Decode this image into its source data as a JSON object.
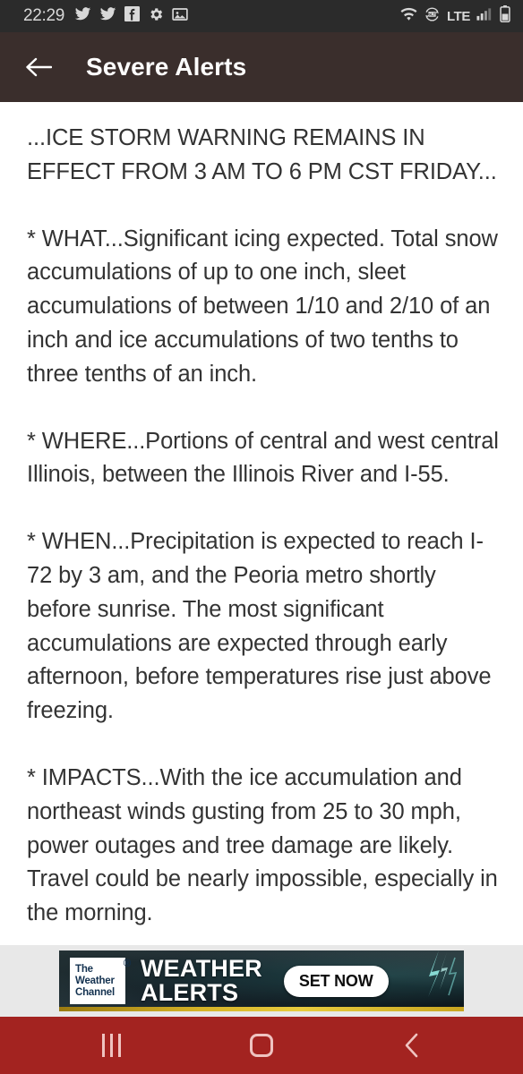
{
  "status_bar": {
    "clock": "22:29",
    "left_icons": [
      "twitter-icon",
      "twitter-icon",
      "facebook-icon",
      "gear-icon",
      "photo-icon"
    ],
    "right_icons": [
      "wifi-icon",
      "volte-icon",
      "signal-bars-icon",
      "battery-icon"
    ],
    "volte_label": "VoLTE",
    "network_label": "LTE",
    "background_color": "#2b2b2b"
  },
  "app_bar": {
    "back_label": "Back",
    "title": "Severe Alerts",
    "background_color": "#3a2e2c"
  },
  "alert": {
    "paragraphs": [
      "...ICE STORM WARNING REMAINS IN EFFECT FROM 3 AM TO 6 PM CST FRIDAY...",
      "* WHAT...Significant icing expected. Total snow accumulations of up to one inch, sleet accumulations of between 1/10 and 2/10 of an inch and ice accumulations of two tenths to three tenths of an inch.",
      "* WHERE...Portions of central and west central Illinois, between the Illinois River and I-55.",
      "* WHEN...Precipitation is expected to reach I-72 by 3 am, and the Peoria metro shortly before sunrise. The most significant accumulations are expected through early afternoon, before temperatures rise just above freezing.",
      "* IMPACTS...With the ice accumulation and northeast winds gusting from 25 to 30 mph, power outages and tree damage are likely. Travel could be nearly impossible, especially in the morning."
    ],
    "text_color": "#333333"
  },
  "ad": {
    "logo_line1": "The",
    "logo_line2": "Weather",
    "logo_line3": "Channel",
    "logo_trademark": "®",
    "headline_line1": "WEATHER",
    "headline_line2": "ALERTS",
    "cta_label": "SET NOW",
    "background_color": "#e8e8e8"
  },
  "nav_bar": {
    "recents_label": "Recents",
    "home_label": "Home",
    "back_label": "Back",
    "background_color": "#a32320",
    "icon_color": "#efc3c0"
  }
}
